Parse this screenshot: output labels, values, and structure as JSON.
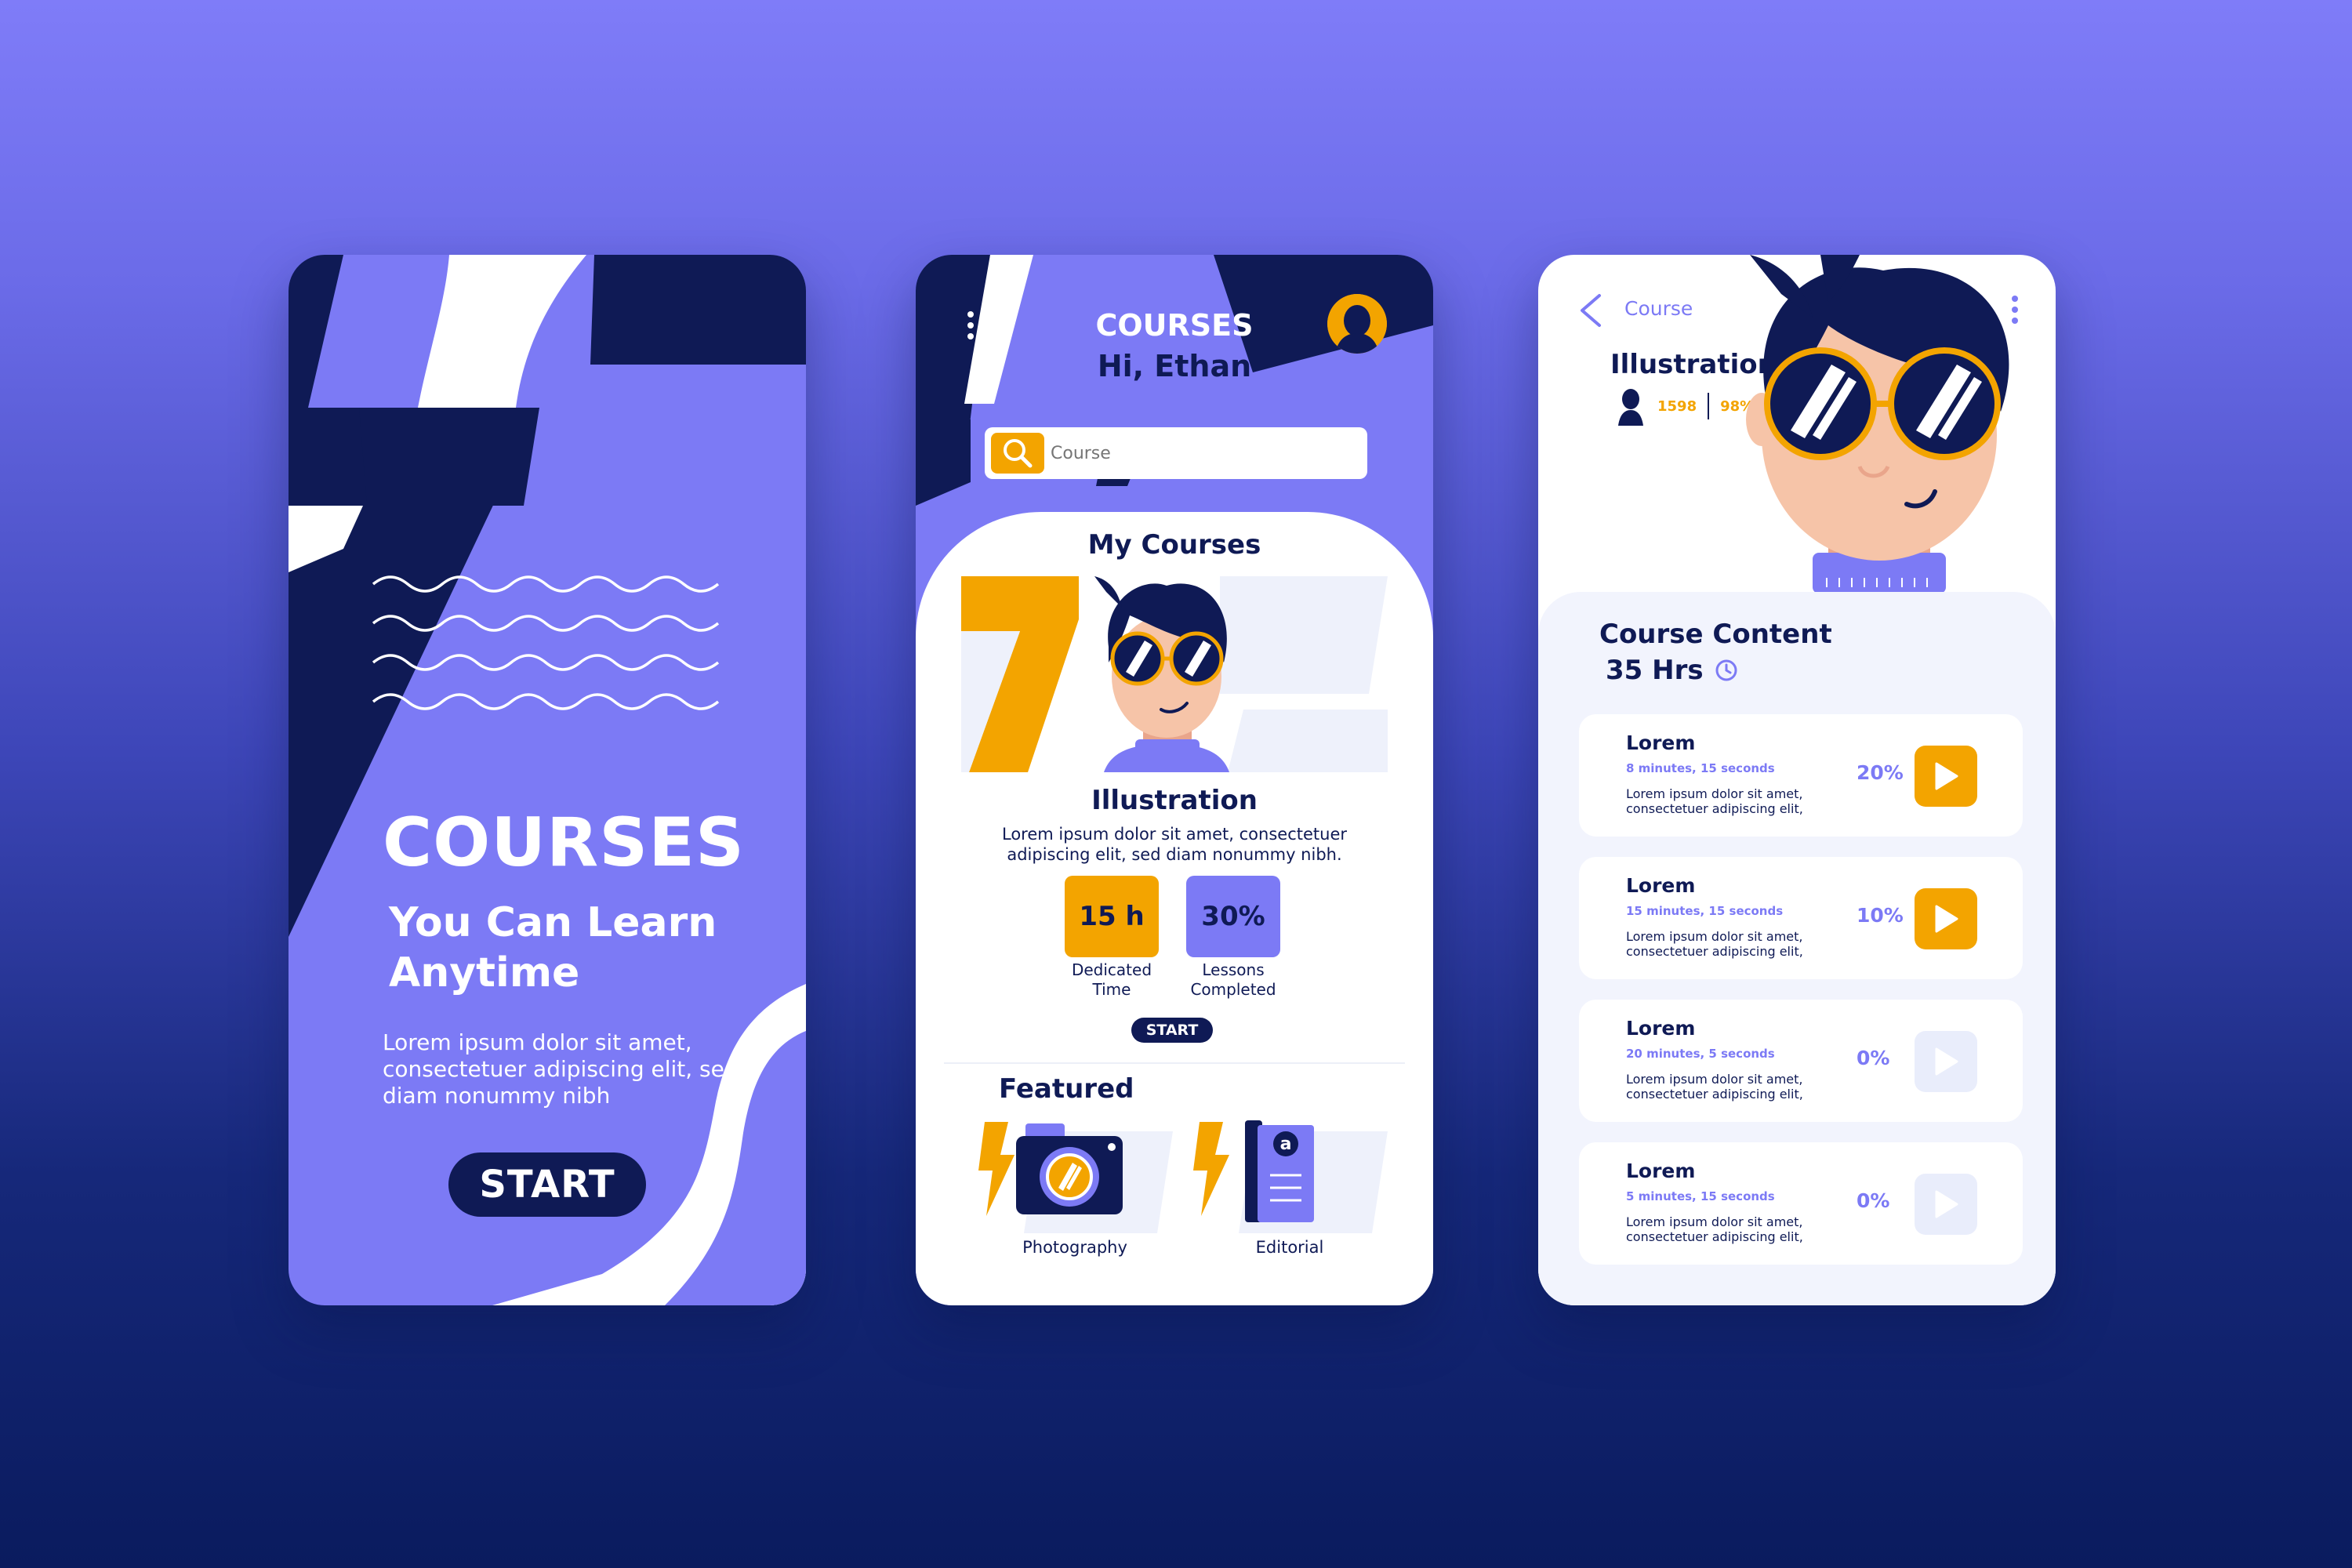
{
  "colors": {
    "primary": "#7c7af5",
    "dark_navy": "#0f1a55",
    "accent_orange": "#f3a400",
    "white": "#ffffff",
    "panel_bg": "#f2f4fd"
  },
  "onboarding": {
    "title": "COURSES",
    "subtitle": "You Can Learn Anytime",
    "body": "Lorem ipsum dolor sit amet, consectetuer adipiscing elit, sed diam nonummy nibh",
    "start_label": "START"
  },
  "home": {
    "menu_icon": "kebab-menu-icon",
    "title": "COURSES",
    "greeting": "Hi, Ethan",
    "avatar_icon": "user-avatar-icon",
    "search": {
      "icon": "search-icon",
      "placeholder": "Course"
    },
    "my_courses_heading": "My Courses",
    "course": {
      "title": "Illustration",
      "description": "Lorem ipsum dolor sit amet, consectetuer adipiscing elit, sed diam nonummy nibh.",
      "stats": [
        {
          "value": "15 h",
          "label": "Dedicated Time"
        },
        {
          "value": "30%",
          "label": "Lessons Completed"
        }
      ],
      "start_label": "START"
    },
    "featured_heading": "Featured",
    "featured": [
      {
        "label": "Photography",
        "icon": "camera-icon"
      },
      {
        "label": "Editorial",
        "icon": "book-icon"
      }
    ]
  },
  "detail": {
    "back_icon": "chevron-left-icon",
    "breadcrumb": "Course",
    "menu_icon": "kebab-menu-icon",
    "title": "Illustration",
    "stat_views": "1598",
    "stat_rating": "98%",
    "content_heading": "Course Content",
    "total_hours": "35 Hrs",
    "clock_icon": "clock-icon",
    "lessons": [
      {
        "title": "Lorem",
        "duration": "8 minutes, 15 seconds",
        "desc": "Lorem ipsum dolor sit amet, consectetuer adipiscing elit,",
        "progress": "20%",
        "play_state": "active"
      },
      {
        "title": "Lorem",
        "duration": "15 minutes, 15 seconds",
        "desc": "Lorem ipsum dolor sit amet, consectetuer adipiscing elit,",
        "progress": "10%",
        "play_state": "active"
      },
      {
        "title": "Lorem",
        "duration": "20 minutes, 5 seconds",
        "desc": "Lorem ipsum dolor sit amet, consectetuer adipiscing elit,",
        "progress": "0%",
        "play_state": "inactive"
      },
      {
        "title": "Lorem",
        "duration": "5 minutes, 15 seconds",
        "desc": "Lorem ipsum dolor sit amet, consectetuer adipiscing elit,",
        "progress": "0%",
        "play_state": "inactive"
      }
    ]
  }
}
